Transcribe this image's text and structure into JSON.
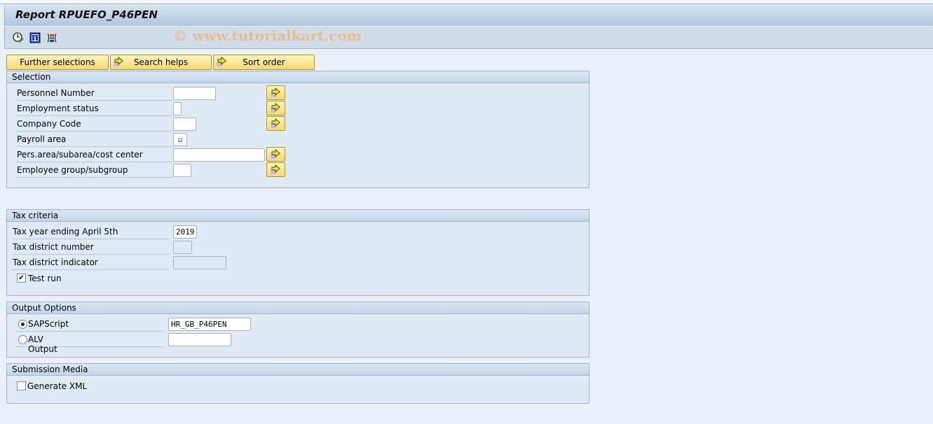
{
  "window": {
    "title": "Report RPUEFO_P46PEN",
    "watermark": "© www.tutorialkart.com"
  },
  "toolbar": {
    "icons": [
      "execute-clock-icon",
      "info-icon",
      "selection-variant-icon"
    ]
  },
  "buttons": {
    "further_selections": "Further selections",
    "search_helps": "Search helps",
    "sort_order": "Sort order"
  },
  "selection": {
    "title": "Selection",
    "fields": [
      {
        "label": "Personnel Number",
        "value": ""
      },
      {
        "label": "Employment status",
        "value": ""
      },
      {
        "label": "Company Code",
        "value": ""
      },
      {
        "label": "Payroll area",
        "value": "checked"
      },
      {
        "label": "Pers.area/subarea/cost center",
        "value": ""
      },
      {
        "label": "Employee group/subgroup",
        "value": ""
      }
    ]
  },
  "tax": {
    "title": "Tax criteria",
    "year_label": "Tax year ending April 5th",
    "year_value": "2019",
    "district_number_label": "Tax district number",
    "district_number_value": "",
    "district_indicator_label": "Tax district indicator",
    "district_indicator_value": "",
    "test_run_label": "Test run",
    "test_run_checked": true
  },
  "output": {
    "title": "Output Options",
    "sapscript_label": "SAPScript",
    "sapscript_value": "HR_GB_P46PEN",
    "sapscript_selected": true,
    "alv_label": "ALV Output",
    "alv_value": ""
  },
  "submission": {
    "title": "Submission Media",
    "xml_label": "Generate XML",
    "xml_checked": false
  },
  "colors": {
    "button_yellow": "#f8d96e",
    "background": "#e9f0f7",
    "group_header": "#c3d6e9"
  }
}
